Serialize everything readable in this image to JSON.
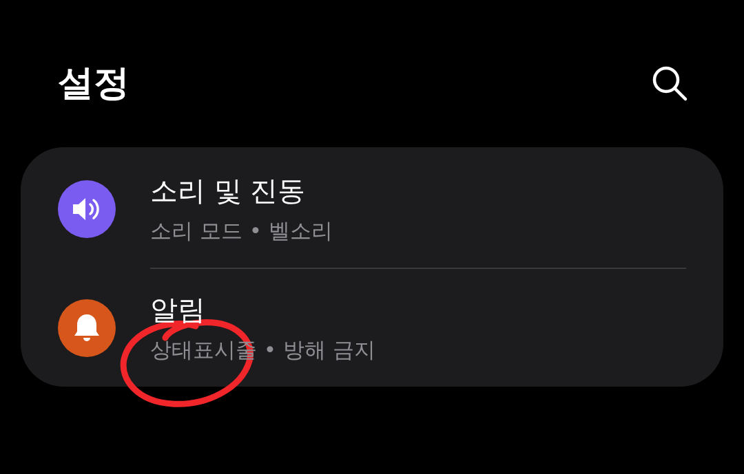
{
  "header": {
    "title": "설정"
  },
  "settings": [
    {
      "kind": "sound",
      "color": "#7b5cf0",
      "title": "소리 및 진동",
      "subtitle": "소리 모드 • 벨소리"
    },
    {
      "kind": "bell",
      "color": "#d6561b",
      "title": "알림",
      "subtitle": "상태표시줄 • 방해 금지"
    }
  ],
  "annotation": {
    "kind": "circle",
    "color": "#f0262a"
  }
}
